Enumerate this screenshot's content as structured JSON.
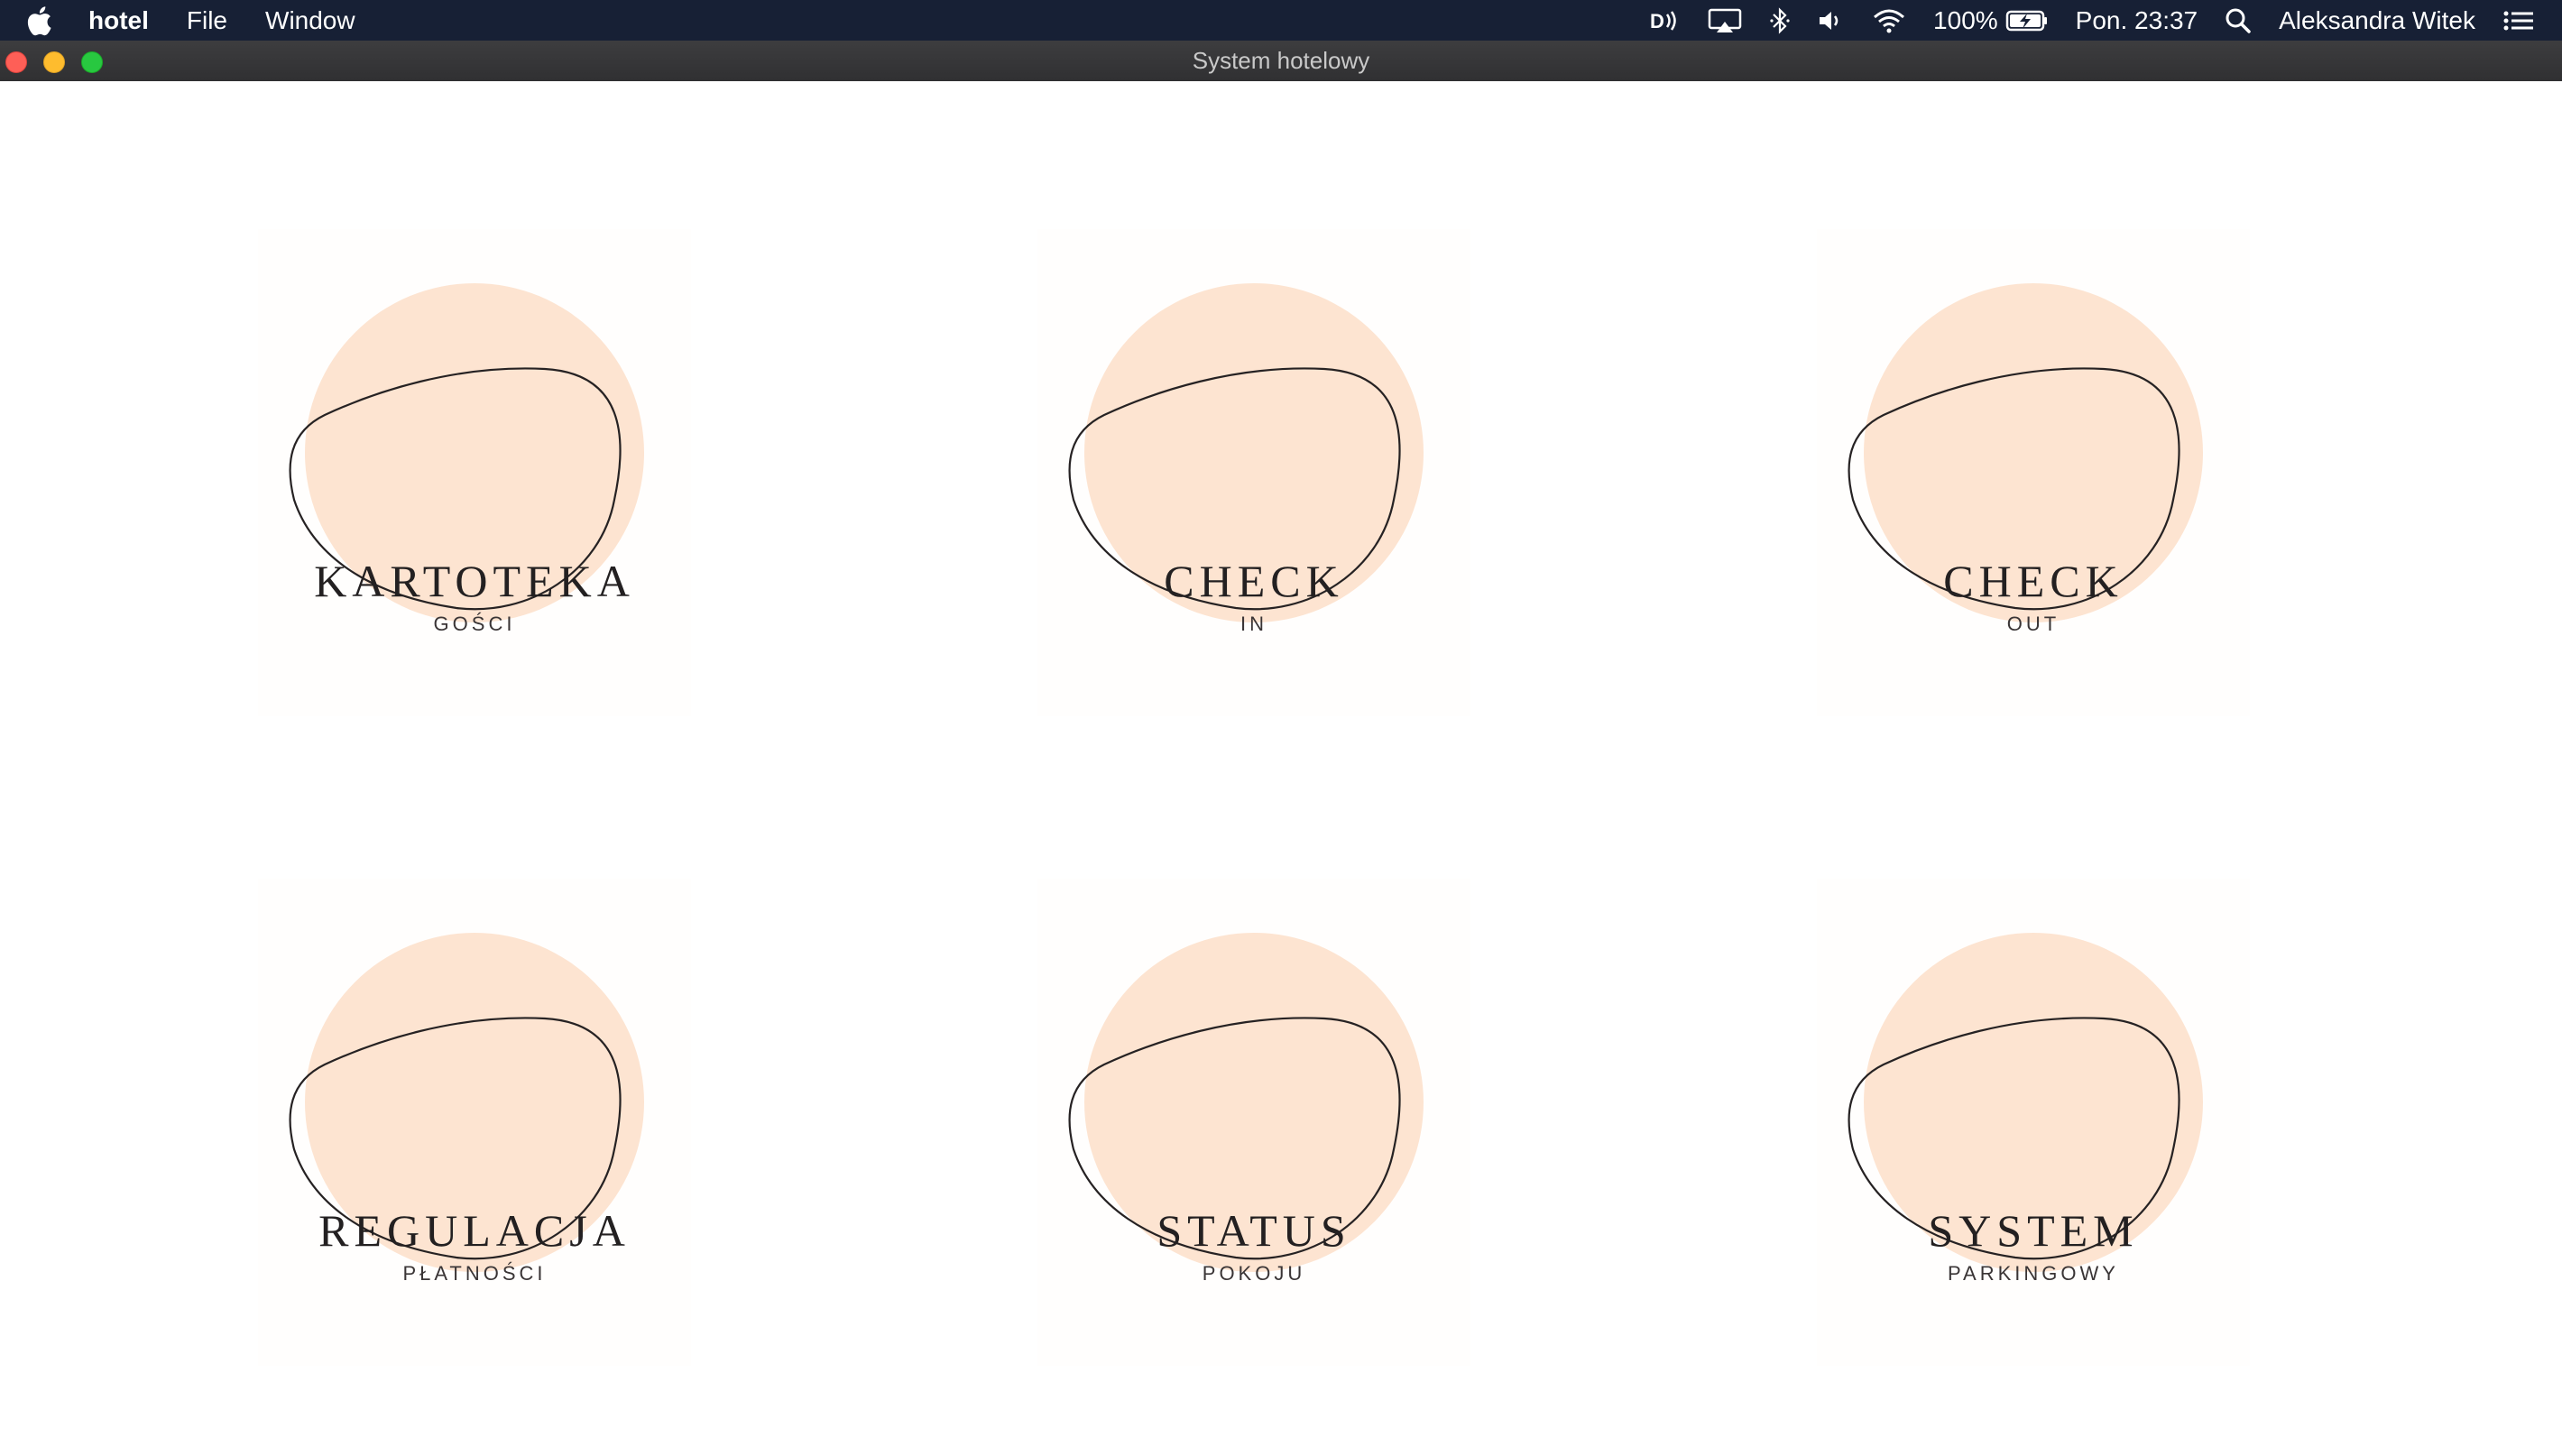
{
  "menubar": {
    "app_name": "hotel",
    "menus": [
      "File",
      "Window"
    ],
    "battery": "100%",
    "clock": "Pon. 23:37",
    "user": "Aleksandra Witek",
    "icons": [
      "apple-icon",
      "siri-icon",
      "airplay-icon",
      "bluetooth-icon",
      "volume-icon",
      "wifi-icon",
      "battery-icon",
      "spotlight-icon",
      "notification-center-icon"
    ]
  },
  "window": {
    "title": "System hotelowy"
  },
  "tiles": [
    {
      "main": "KARTOTEKA",
      "sub": "GOŚCI"
    },
    {
      "main": "CHECK",
      "sub": "IN"
    },
    {
      "main": "CHECK",
      "sub": "OUT"
    },
    {
      "main": "REGULACJA",
      "sub": "PŁATNOŚCI"
    },
    {
      "main": "STATUS",
      "sub": "POKOJU"
    },
    {
      "main": "SYSTEM",
      "sub": "PARKINGOWY"
    }
  ],
  "colors": {
    "menubar_bg": "#172035",
    "titlebar_bg": "#353537",
    "blob_fill": "#fde4d1",
    "outline": "#262223",
    "text": "#232021"
  }
}
